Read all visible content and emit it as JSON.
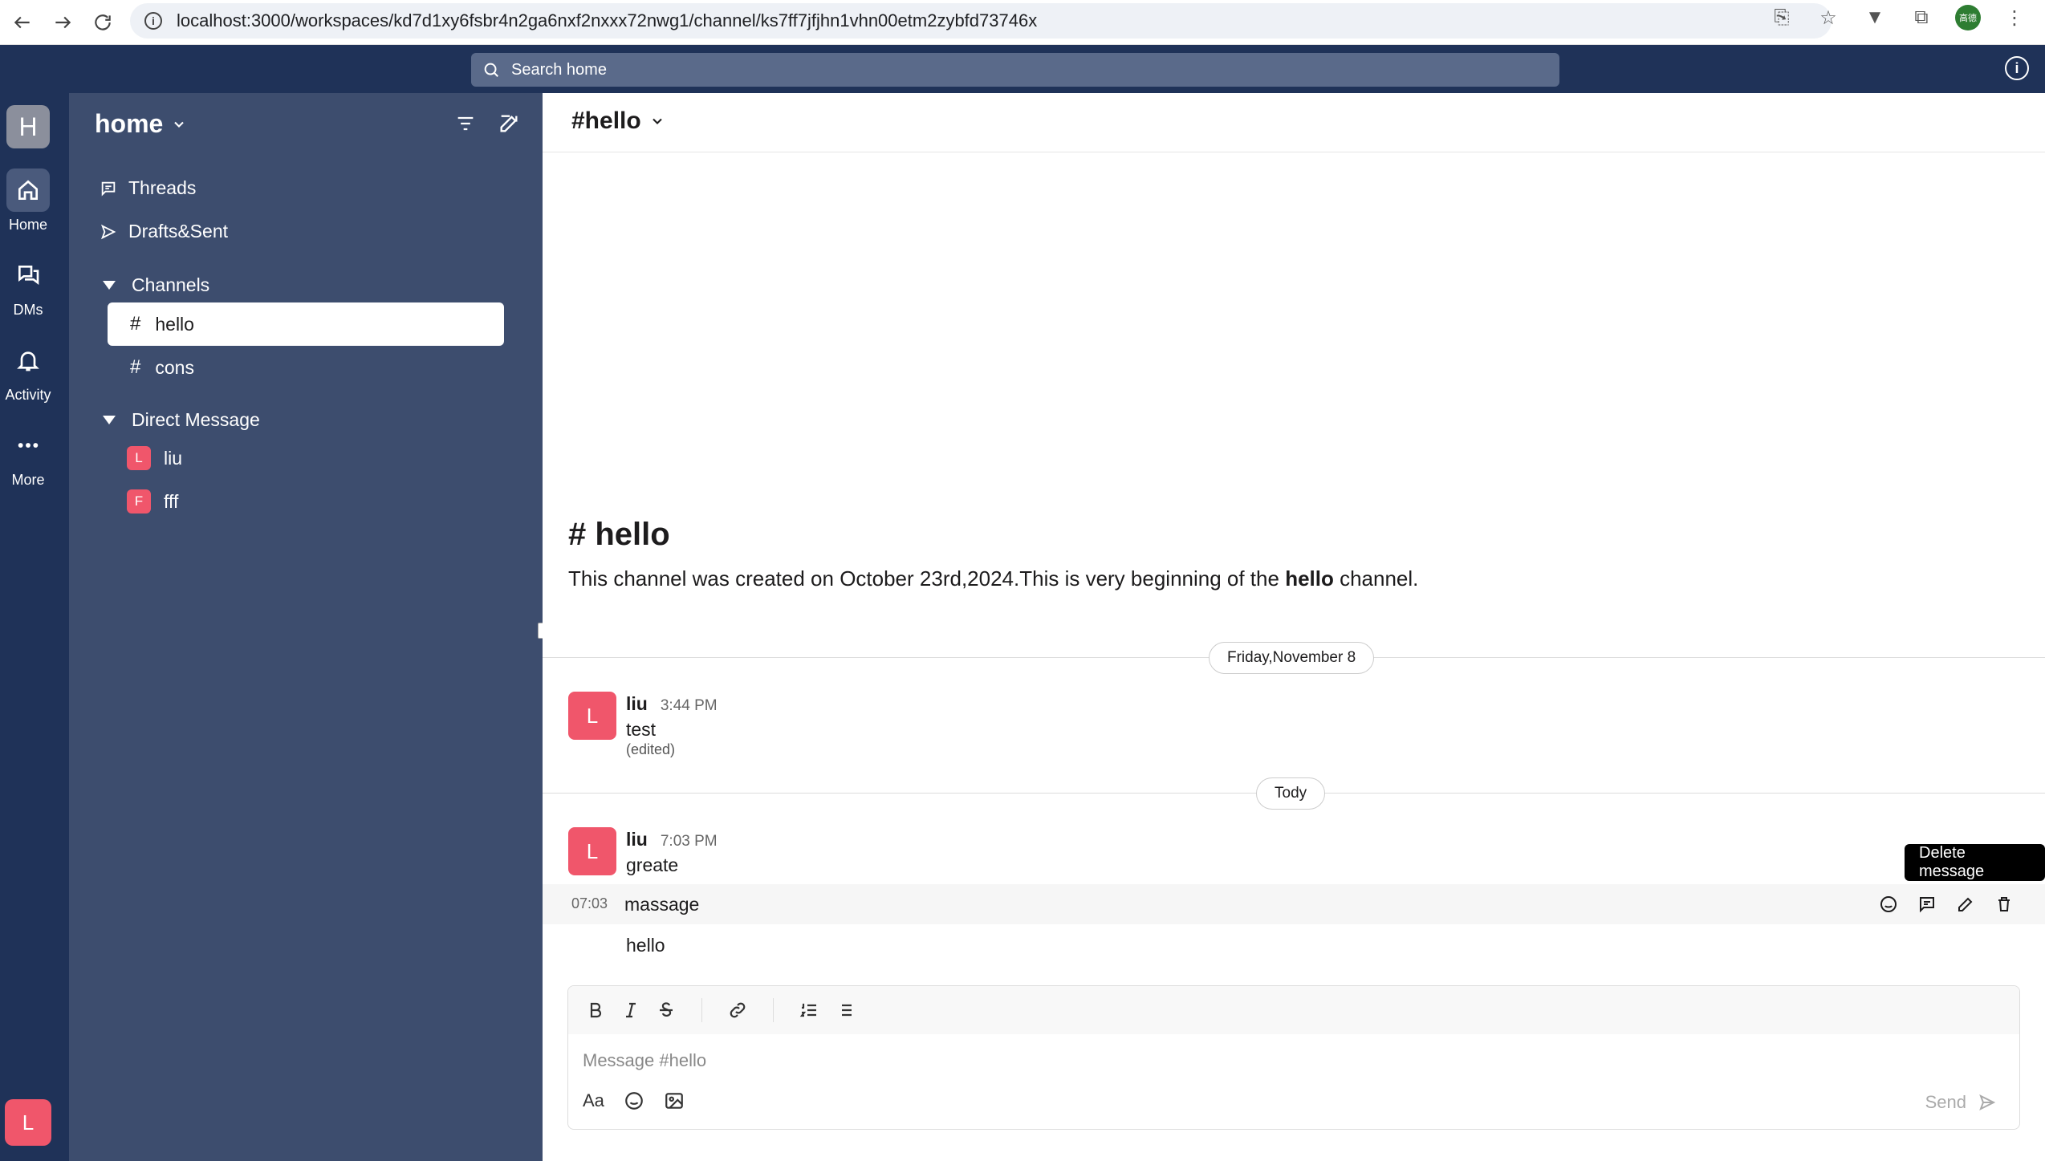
{
  "browser": {
    "url": "localhost:3000/workspaces/kd7d1xy6fsbr4n2ga6nxf2nxxx72nwg1/channel/ks7ff7jfjhn1vhn00etm2zybfd73746x",
    "profile_label": "高德"
  },
  "topbar": {
    "search_placeholder": "Search home"
  },
  "rail": {
    "workspace_initial": "H",
    "items": [
      {
        "label": "Home"
      },
      {
        "label": "DMs"
      },
      {
        "label": "Activity"
      },
      {
        "label": "More"
      }
    ],
    "user_initial": "L"
  },
  "sidebar": {
    "workspace_name": "home",
    "threads_label": "Threads",
    "drafts_label": "Drafts&Sent",
    "channels_section": "Channels",
    "channels": [
      {
        "name": "hello"
      },
      {
        "name": "cons"
      }
    ],
    "dm_section": "Direct Message",
    "dms": [
      {
        "initial": "L",
        "name": "liu"
      },
      {
        "initial": "F",
        "name": "fff"
      }
    ]
  },
  "channel": {
    "header": "#hello",
    "intro_title": "# hello",
    "intro_prefix": "This channel was created on October 23rd,2024.This is very beginning of the ",
    "intro_name": "hello",
    "intro_suffix": " channel."
  },
  "messages": {
    "date1": "Friday,November 8",
    "m1": {
      "initial": "L",
      "user": "liu",
      "time": "3:44 PM",
      "text": "test",
      "edited": "(edited)"
    },
    "date2": "Tody",
    "m2": {
      "initial": "L",
      "user": "liu",
      "time": "7:03 PM",
      "text": "greate"
    },
    "m3": {
      "short_time": "07:03",
      "text": "massage"
    },
    "m4": {
      "text": "hello"
    },
    "tooltip": "Delete message"
  },
  "composer": {
    "placeholder": "Message #hello",
    "format_label": "Aa",
    "send_label": "Send"
  }
}
